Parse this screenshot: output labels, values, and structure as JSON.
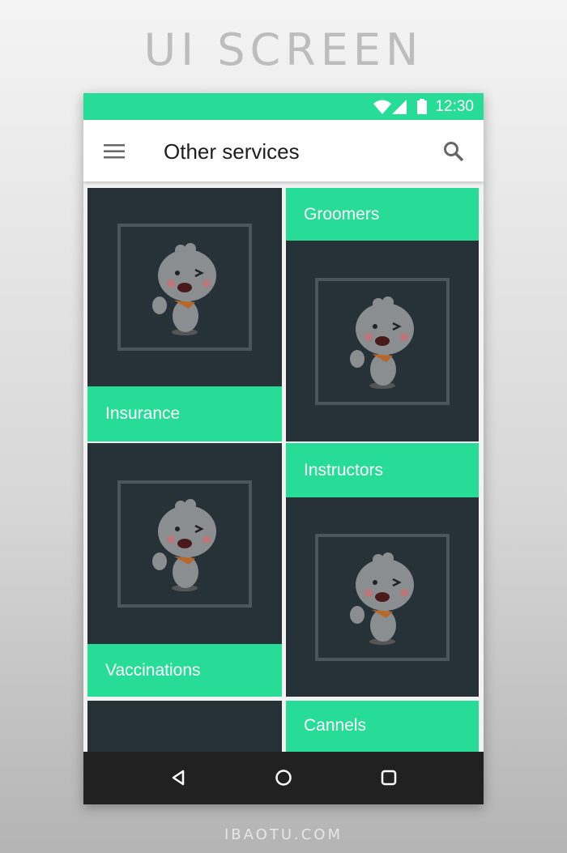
{
  "heading": "UI SCREEN",
  "footer": "IBAOTU.COM",
  "status_bar": {
    "time": "12:30",
    "icons": [
      "wifi-icon",
      "signal-icon",
      "battery-icon"
    ],
    "color": "#27dc96"
  },
  "app_bar": {
    "title": "Other services",
    "menu_icon": "hamburger-menu-icon",
    "search_icon": "search-icon"
  },
  "cards": [
    {
      "label": "Insurance"
    },
    {
      "label": "Groomers"
    },
    {
      "label": "Vaccinations"
    },
    {
      "label": "Instructors"
    },
    {
      "label": ""
    },
    {
      "label": "Cannels"
    }
  ],
  "nav_bar": {
    "icons": [
      "back-icon",
      "home-icon",
      "recents-icon"
    ]
  },
  "colors": {
    "accent": "#27dc96",
    "card_bg": "#273238",
    "nav_bg": "#212121"
  }
}
